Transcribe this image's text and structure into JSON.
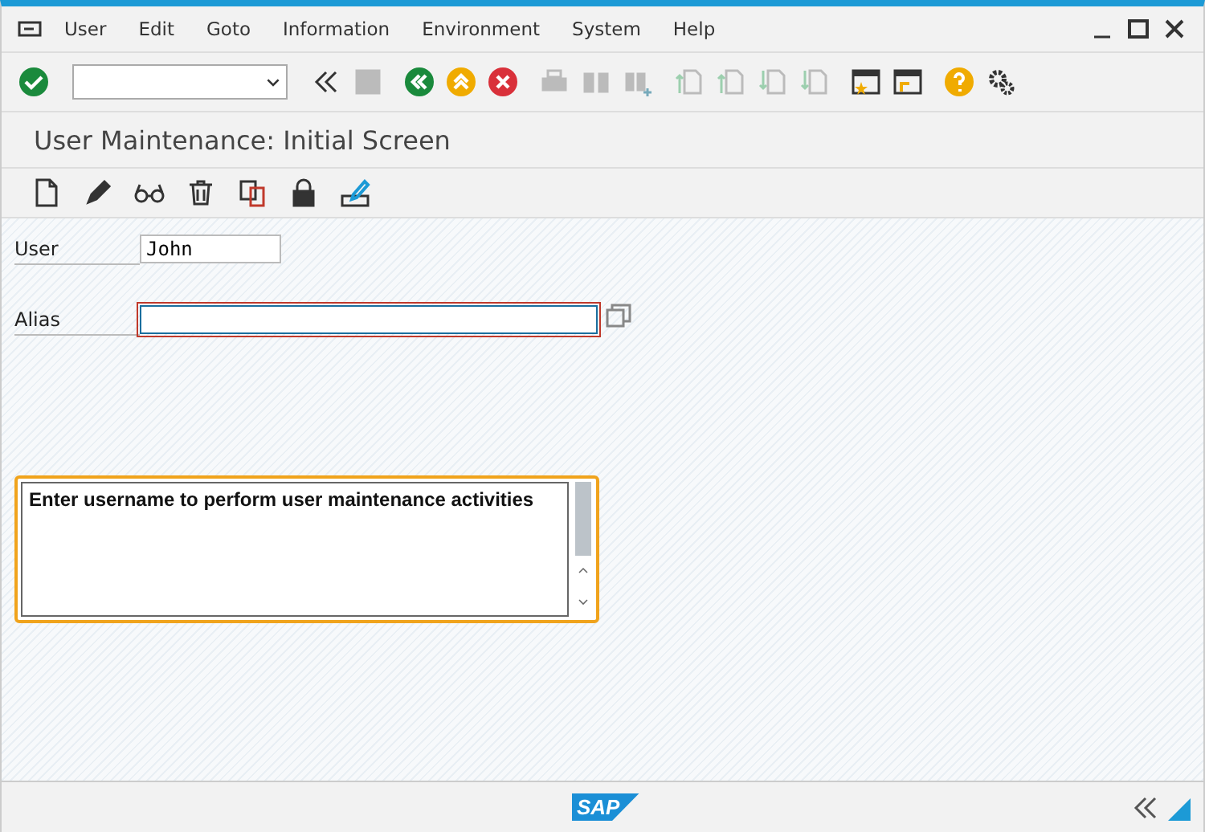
{
  "menu": [
    "User",
    "Edit",
    "Goto",
    "Information",
    "Environment",
    "System",
    "Help"
  ],
  "screen_title": "User Maintenance: Initial Screen",
  "fields": [
    {
      "label": "User",
      "value": "John",
      "focused": false
    },
    {
      "label": "Alias",
      "focused": true
    }
  ],
  "message_box": {
    "text": "Enter username to perform user maintenance activities"
  },
  "footer": {
    "logo": "SAP"
  }
}
